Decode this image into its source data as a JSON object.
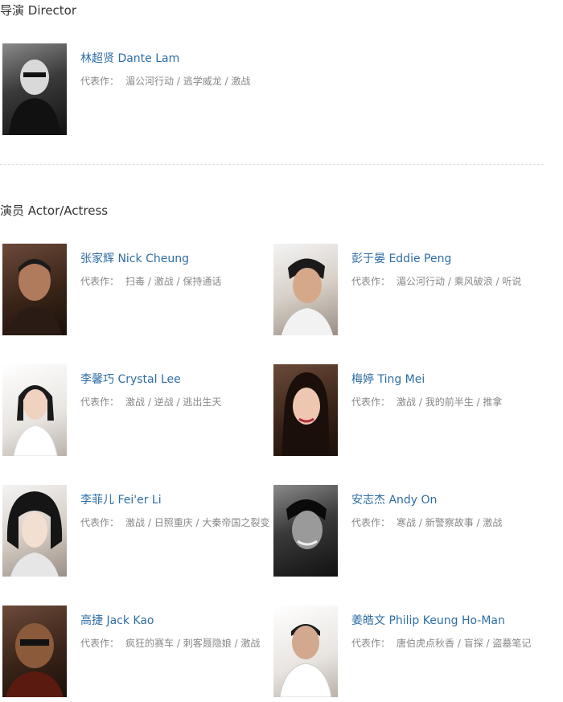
{
  "director_section": {
    "title": "导演 Director"
  },
  "actor_section": {
    "title": "演员 Actor/Actress"
  },
  "works_label": "代表作：",
  "director": {
    "name": "林超贤 Dante Lam",
    "works": "湄公河行动 / 逃学威龙 / 激战"
  },
  "actors": [
    {
      "name": "张家辉 Nick Cheung",
      "works": "扫毒 / 激战 / 保持通话"
    },
    {
      "name": "彭于晏 Eddie Peng",
      "works": "湄公河行动 / 乘风破浪 / 听说"
    },
    {
      "name": "李馨巧 Crystal Lee",
      "works": "激战 / 逆战 / 逃出生天"
    },
    {
      "name": "梅婷 Ting Mei",
      "works": "激战 / 我的前半生 / 推拿"
    },
    {
      "name": "李菲儿 Fei'er Li",
      "works": "激战 / 日照重庆 / 大秦帝国之裂变"
    },
    {
      "name": "安志杰 Andy On",
      "works": "寒战 / 新警察故事 / 激战"
    },
    {
      "name": "高捷 Jack Kao",
      "works": "疯狂的赛车 / 刺客聂隐娘 / 激战"
    },
    {
      "name": "姜皓文 Philip Keung Ho-Man",
      "works": "唐伯虎点秋香 / 盲探 / 盗墓笔记"
    }
  ]
}
